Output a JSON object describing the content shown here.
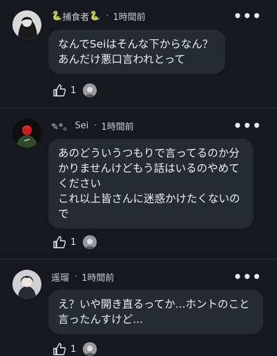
{
  "comments": [
    {
      "author": "捕食者",
      "author_prefix": "🐍",
      "author_suffix": "🐍",
      "time": "1時間前",
      "lines": [
        "なんでSeiはそんな下からなん？",
        "あんだけ悪口言われとって"
      ],
      "likes": "1"
    },
    {
      "author": "Sei",
      "author_prefix": "✎*。",
      "author_suffix": "",
      "time": "1時間前",
      "lines": [
        "あのどういうつもりで言ってるのか分",
        "かりませんけどもう話はいるのやめて",
        "ください",
        "これ以上皆さんに迷惑かけたくないの",
        "で"
      ],
      "likes": "1"
    },
    {
      "author": "遥瑠",
      "author_prefix": "",
      "author_suffix": "",
      "time": "1時間前",
      "lines": [
        "え？いや開き直るってか...ホントのこと",
        "言ったんすけど..."
      ],
      "likes": "1"
    }
  ],
  "separator": "·",
  "more_glyph": "•••"
}
